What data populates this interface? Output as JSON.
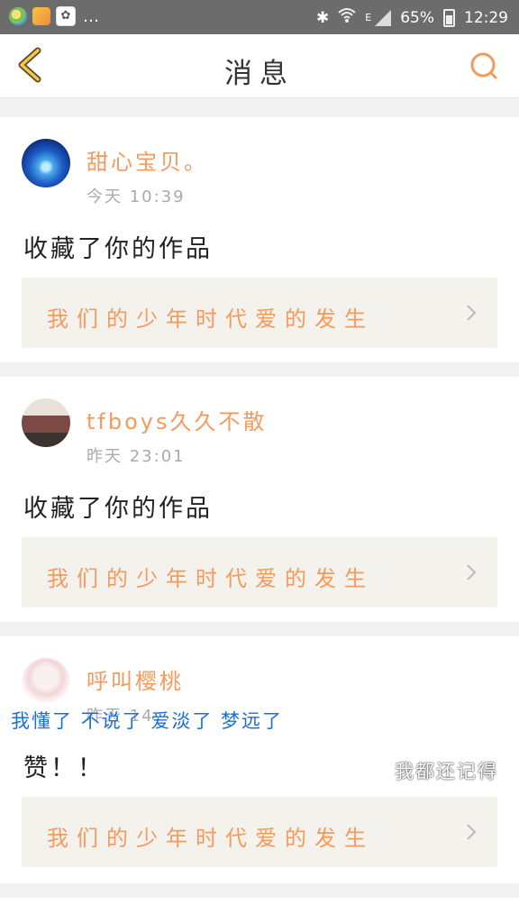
{
  "status_bar": {
    "battery": "65%",
    "time": "12:29",
    "network": "E"
  },
  "nav": {
    "title": "消息"
  },
  "messages": [
    {
      "user": "甜心宝贝。",
      "time": "今天 10:39",
      "action": "收藏了你的作品",
      "work_title": "我们的少年时代爱的发生"
    },
    {
      "user": "tfboys久久不散",
      "time": "昨天 23:01",
      "action": "收藏了你的作品",
      "work_title": "我们的少年时代爱的发生"
    },
    {
      "user": "呼叫樱桃",
      "time": "昨天 14:",
      "action": "赞！！",
      "work_title": "我们的少年时代爱的发生"
    }
  ],
  "overlays": {
    "blue_text": "我懂了 不说了 爱淡了 梦远了",
    "right_text": "我都还记得"
  }
}
